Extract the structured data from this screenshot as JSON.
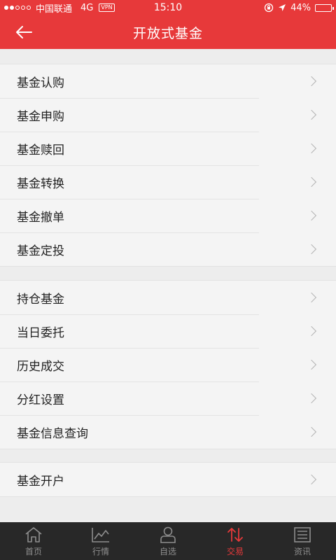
{
  "status_bar": {
    "carrier": "中国联通",
    "network": "4G",
    "vpn": "VPN",
    "time": "15:10",
    "battery": "44%",
    "battery_level": 0.44
  },
  "nav": {
    "title": "开放式基金",
    "back_icon": "arrow-left-icon"
  },
  "groups": [
    {
      "items": [
        {
          "label": "基金认购"
        },
        {
          "label": "基金申购"
        },
        {
          "label": "基金赎回"
        },
        {
          "label": "基金转换"
        },
        {
          "label": "基金撤单"
        },
        {
          "label": "基金定投"
        }
      ]
    },
    {
      "items": [
        {
          "label": "持仓基金"
        },
        {
          "label": "当日委托"
        },
        {
          "label": "历史成交"
        },
        {
          "label": "分红设置"
        },
        {
          "label": "基金信息查询"
        }
      ]
    },
    {
      "items": [
        {
          "label": "基金开户"
        }
      ]
    }
  ],
  "tabbar": {
    "tabs": [
      {
        "label": "首页",
        "icon": "home-icon"
      },
      {
        "label": "行情",
        "icon": "chart-icon"
      },
      {
        "label": "自选",
        "icon": "user-icon"
      },
      {
        "label": "交易",
        "icon": "transfer-icon",
        "active": true
      },
      {
        "label": "资讯",
        "icon": "news-icon"
      }
    ]
  },
  "colors": {
    "accent": "#e7393a",
    "tabbar": "#282828"
  }
}
